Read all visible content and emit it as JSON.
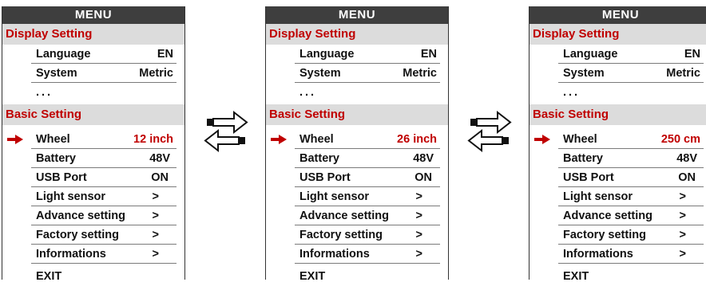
{
  "menu_title": "MENU",
  "display_section": "Display Setting",
  "basic_section": "Basic Setting",
  "display_rows": [
    {
      "label": "Language",
      "value": "EN"
    },
    {
      "label": "System",
      "value": "Metric"
    },
    {
      "label": "...",
      "value": ""
    }
  ],
  "basic_rows": [
    {
      "label": "Battery",
      "value": "48V"
    },
    {
      "label": "USB Port",
      "value": "ON"
    },
    {
      "label": "Light sensor",
      "value": ">"
    },
    {
      "label": "Advance setting",
      "value": ">"
    },
    {
      "label": "Factory setting",
      "value": ">"
    },
    {
      "label": "Informations",
      "value": ">"
    }
  ],
  "wheel_label": "Wheel",
  "wheel_values": [
    "12 inch",
    "26 inch",
    "250 cm"
  ],
  "exit_label": "EXIT",
  "colors": {
    "accent_red": "#c00000",
    "title_bar": "#3e3e3e",
    "section_bg": "#dcdcdc"
  },
  "icons": {
    "selection": "right-arrow-icon",
    "swap": "swap-arrows-icon"
  }
}
